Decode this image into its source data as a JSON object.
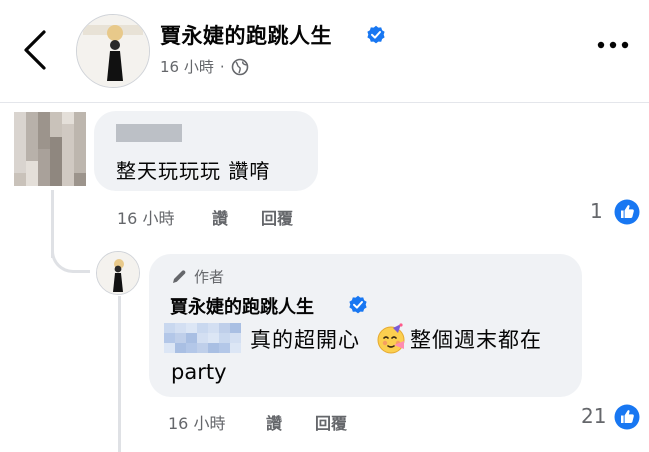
{
  "header": {
    "page_name": "賈永婕的跑跳人生",
    "time": "16 小時",
    "separator": "·",
    "icons": {
      "back": "chevron-left-icon",
      "verified": "verified-badge-icon",
      "privacy": "globe-icon",
      "more": "more-dots-icon"
    }
  },
  "comment": {
    "text": "整天玩玩玩 讚唷",
    "time": "16 小時",
    "like_label": "讚",
    "reply_label": "回覆",
    "like_count": "1"
  },
  "reply": {
    "author_badge": "作者",
    "page_name": "賈永婕的跑跳人生",
    "text_part1": "真的超開心",
    "emoji": "partying-face-emoji",
    "text_part2": "整個週末都在",
    "text_part3": "party",
    "time": "16 小時",
    "like_label": "讚",
    "reply_label": "回覆",
    "like_count": "21"
  },
  "colors": {
    "accent": "#1877f2",
    "secondary_text": "#65676b",
    "bubble": "#f0f2f5"
  }
}
